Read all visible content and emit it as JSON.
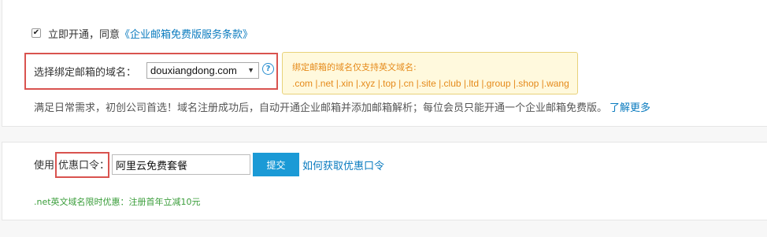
{
  "open_service": {
    "checked": true,
    "label": "立即开通，同意",
    "terms_link": "《企业邮箱免费版服务条款》"
  },
  "domain": {
    "label": "选择绑定邮箱的域名：",
    "selected": "douxiangdong.com",
    "help_icon": "question-circle-icon",
    "tooltip": {
      "title": "绑定邮箱的域名仅支持英文域名:",
      "domains": ".com |.net |.xin |.xyz |.top |.cn |.site |.club |.ltd |.group |.shop |.wang"
    }
  },
  "description": {
    "text": "满足日常需求，初创公司首选！域名注册成功后，自动开通企业邮箱并添加邮箱解析；每位会员只能开通一个企业邮箱免费版。",
    "learn_more": "了解更多"
  },
  "coupon": {
    "label_prefix": "使用",
    "label": "优惠口令：",
    "value": "阿里云免费套餐",
    "submit": "提交",
    "howto_link": "如何获取优惠口令"
  },
  "promo": ".net英文域名限时优惠：注册首年立减10元",
  "colors": {
    "link": "#0a7bbf",
    "highlight_border": "#d9534f",
    "button": "#1b9ad6",
    "tooltip_text": "#e58a1a",
    "promo_text": "#3a9d3a"
  }
}
